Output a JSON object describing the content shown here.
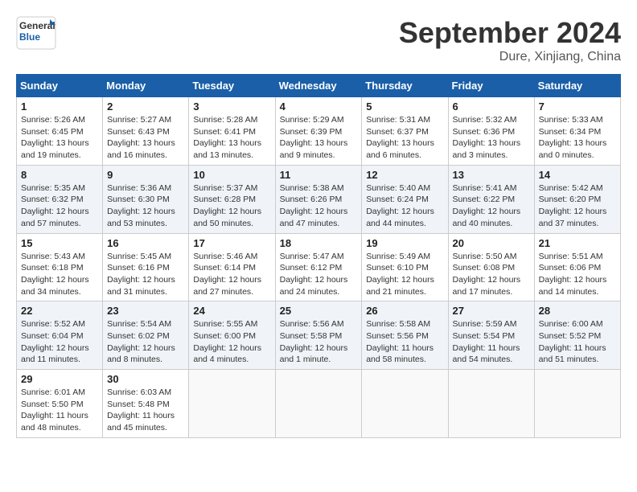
{
  "header": {
    "logo_line1": "General",
    "logo_line2": "Blue",
    "month_title": "September 2024",
    "location": "Dure, Xinjiang, China"
  },
  "days_of_week": [
    "Sunday",
    "Monday",
    "Tuesday",
    "Wednesday",
    "Thursday",
    "Friday",
    "Saturday"
  ],
  "weeks": [
    [
      {
        "day": "1",
        "info": "Sunrise: 5:26 AM\nSunset: 6:45 PM\nDaylight: 13 hours\nand 19 minutes."
      },
      {
        "day": "2",
        "info": "Sunrise: 5:27 AM\nSunset: 6:43 PM\nDaylight: 13 hours\nand 16 minutes."
      },
      {
        "day": "3",
        "info": "Sunrise: 5:28 AM\nSunset: 6:41 PM\nDaylight: 13 hours\nand 13 minutes."
      },
      {
        "day": "4",
        "info": "Sunrise: 5:29 AM\nSunset: 6:39 PM\nDaylight: 13 hours\nand 9 minutes."
      },
      {
        "day": "5",
        "info": "Sunrise: 5:31 AM\nSunset: 6:37 PM\nDaylight: 13 hours\nand 6 minutes."
      },
      {
        "day": "6",
        "info": "Sunrise: 5:32 AM\nSunset: 6:36 PM\nDaylight: 13 hours\nand 3 minutes."
      },
      {
        "day": "7",
        "info": "Sunrise: 5:33 AM\nSunset: 6:34 PM\nDaylight: 13 hours\nand 0 minutes."
      }
    ],
    [
      {
        "day": "8",
        "info": "Sunrise: 5:35 AM\nSunset: 6:32 PM\nDaylight: 12 hours\nand 57 minutes."
      },
      {
        "day": "9",
        "info": "Sunrise: 5:36 AM\nSunset: 6:30 PM\nDaylight: 12 hours\nand 53 minutes."
      },
      {
        "day": "10",
        "info": "Sunrise: 5:37 AM\nSunset: 6:28 PM\nDaylight: 12 hours\nand 50 minutes."
      },
      {
        "day": "11",
        "info": "Sunrise: 5:38 AM\nSunset: 6:26 PM\nDaylight: 12 hours\nand 47 minutes."
      },
      {
        "day": "12",
        "info": "Sunrise: 5:40 AM\nSunset: 6:24 PM\nDaylight: 12 hours\nand 44 minutes."
      },
      {
        "day": "13",
        "info": "Sunrise: 5:41 AM\nSunset: 6:22 PM\nDaylight: 12 hours\nand 40 minutes."
      },
      {
        "day": "14",
        "info": "Sunrise: 5:42 AM\nSunset: 6:20 PM\nDaylight: 12 hours\nand 37 minutes."
      }
    ],
    [
      {
        "day": "15",
        "info": "Sunrise: 5:43 AM\nSunset: 6:18 PM\nDaylight: 12 hours\nand 34 minutes."
      },
      {
        "day": "16",
        "info": "Sunrise: 5:45 AM\nSunset: 6:16 PM\nDaylight: 12 hours\nand 31 minutes."
      },
      {
        "day": "17",
        "info": "Sunrise: 5:46 AM\nSunset: 6:14 PM\nDaylight: 12 hours\nand 27 minutes."
      },
      {
        "day": "18",
        "info": "Sunrise: 5:47 AM\nSunset: 6:12 PM\nDaylight: 12 hours\nand 24 minutes."
      },
      {
        "day": "19",
        "info": "Sunrise: 5:49 AM\nSunset: 6:10 PM\nDaylight: 12 hours\nand 21 minutes."
      },
      {
        "day": "20",
        "info": "Sunrise: 5:50 AM\nSunset: 6:08 PM\nDaylight: 12 hours\nand 17 minutes."
      },
      {
        "day": "21",
        "info": "Sunrise: 5:51 AM\nSunset: 6:06 PM\nDaylight: 12 hours\nand 14 minutes."
      }
    ],
    [
      {
        "day": "22",
        "info": "Sunrise: 5:52 AM\nSunset: 6:04 PM\nDaylight: 12 hours\nand 11 minutes."
      },
      {
        "day": "23",
        "info": "Sunrise: 5:54 AM\nSunset: 6:02 PM\nDaylight: 12 hours\nand 8 minutes."
      },
      {
        "day": "24",
        "info": "Sunrise: 5:55 AM\nSunset: 6:00 PM\nDaylight: 12 hours\nand 4 minutes."
      },
      {
        "day": "25",
        "info": "Sunrise: 5:56 AM\nSunset: 5:58 PM\nDaylight: 12 hours\nand 1 minute."
      },
      {
        "day": "26",
        "info": "Sunrise: 5:58 AM\nSunset: 5:56 PM\nDaylight: 11 hours\nand 58 minutes."
      },
      {
        "day": "27",
        "info": "Sunrise: 5:59 AM\nSunset: 5:54 PM\nDaylight: 11 hours\nand 54 minutes."
      },
      {
        "day": "28",
        "info": "Sunrise: 6:00 AM\nSunset: 5:52 PM\nDaylight: 11 hours\nand 51 minutes."
      }
    ],
    [
      {
        "day": "29",
        "info": "Sunrise: 6:01 AM\nSunset: 5:50 PM\nDaylight: 11 hours\nand 48 minutes."
      },
      {
        "day": "30",
        "info": "Sunrise: 6:03 AM\nSunset: 5:48 PM\nDaylight: 11 hours\nand 45 minutes."
      },
      {
        "day": "",
        "info": ""
      },
      {
        "day": "",
        "info": ""
      },
      {
        "day": "",
        "info": ""
      },
      {
        "day": "",
        "info": ""
      },
      {
        "day": "",
        "info": ""
      }
    ]
  ]
}
